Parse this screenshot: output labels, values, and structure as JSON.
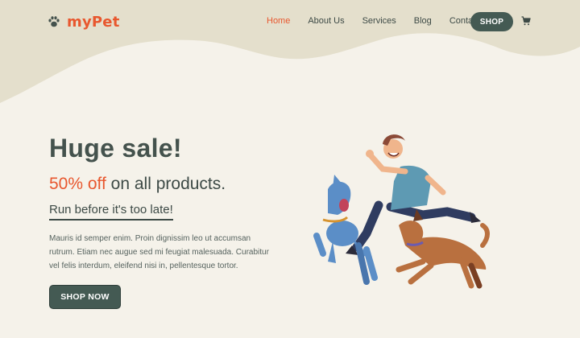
{
  "brand": {
    "name": "myPet",
    "icon": "paw-icon",
    "color": "#e8572e"
  },
  "nav": {
    "items": [
      {
        "label": "Home",
        "active": true
      },
      {
        "label": "About Us",
        "active": false
      },
      {
        "label": "Services",
        "active": false
      },
      {
        "label": "Blog",
        "active": false
      },
      {
        "label": "Contact",
        "active": false
      }
    ],
    "shop_label": "SHOP",
    "cart_icon": "cart-icon"
  },
  "hero": {
    "title": "Huge sale!",
    "discount": "50% off",
    "subtitle_rest": " on all products.",
    "tagline": "Run before it's too late!",
    "body": "Mauris id semper enim. Proin dignissim leo ut accumsan rutrum. Etiam nec augue sed mi feugiat malesuada. Curabitur vel felis interdum, eleifend nisi in, pellentesque tortor.",
    "cta_label": "SHOP NOW"
  },
  "colors": {
    "accent": "#e8572e",
    "primary": "#445a53",
    "background": "#f5f2ea",
    "wave": "#e4dfcc"
  }
}
